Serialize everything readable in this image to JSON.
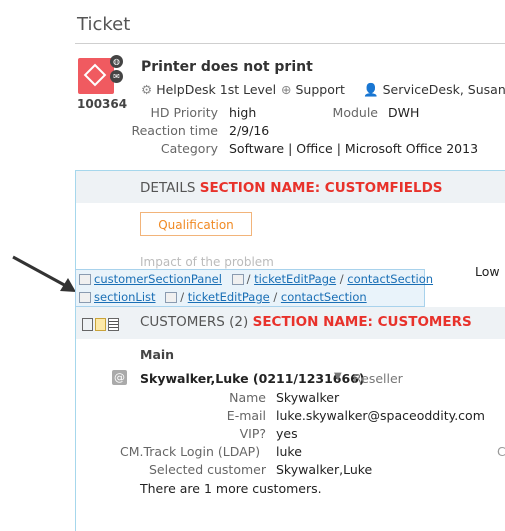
{
  "page_title": "Ticket",
  "ticket": {
    "id": "100364",
    "subject": "Printer does not print",
    "group": "HelpDesk 1st Level",
    "category_type": "Support",
    "assignee": "ServiceDesk, Susan",
    "fields": [
      {
        "label": "HD Priority",
        "value": "high"
      },
      {
        "label": "Reaction time",
        "value": "2/9/16"
      },
      {
        "label": "Category",
        "value": "Software | Office | Microsoft Office 2013"
      }
    ],
    "module_label": "Module",
    "module_value": "DWH"
  },
  "details": {
    "title": "DETAILS",
    "annotation": "SECTION NAME: CUSTOMFIELDS",
    "qualification_label": "Qualification",
    "hidden_text": "Impact of the problem",
    "hidden_value": "Low"
  },
  "tooltip": {
    "row1": [
      "customerSectionPanel",
      "ticketEditPage",
      "contactSection"
    ],
    "row2": [
      "sectionList",
      "ticketEditPage",
      "contactSection"
    ],
    "separator": "/"
  },
  "customers": {
    "title": "CUSTOMERS (2)",
    "annotation": "SECTION NAME: CUSTOMERS",
    "group_label": "Main",
    "primary_name": "Skywalker,Luke (0211/1231666)",
    "primary_role": "Reseller",
    "fields": [
      {
        "label": "Name",
        "value": "Skywalker"
      },
      {
        "label": "E-mail",
        "value": "luke.skywalker@spaceoddity.com"
      },
      {
        "label": "VIP?",
        "value": "yes"
      },
      {
        "label": "CM.Track Login (LDAP)",
        "value": "luke"
      },
      {
        "label": "Selected customer",
        "value": "Skywalker,Luke"
      }
    ],
    "more_text": "There are 1 more customers.",
    "right_cut_letter": "C"
  },
  "colors": {
    "accent_red": "#e8322b",
    "link_blue": "#1a6fb5",
    "orange": "#f08a24",
    "ticket_icon": "#f05a60"
  }
}
